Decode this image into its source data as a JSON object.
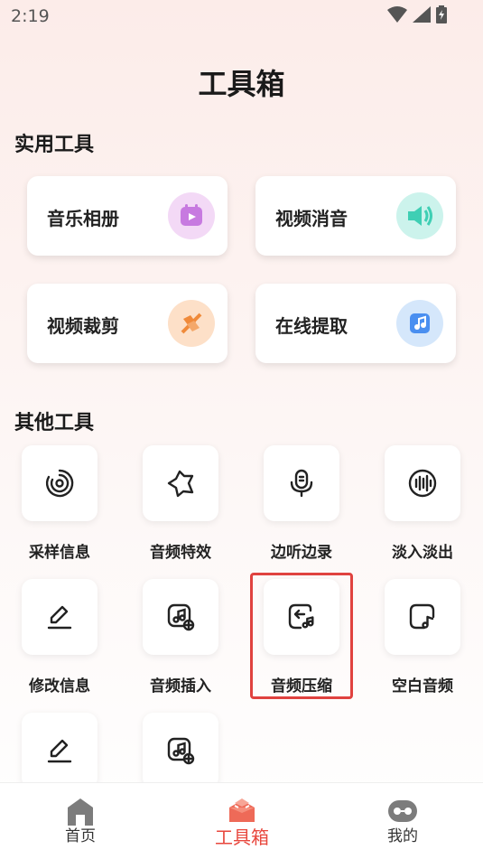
{
  "status": {
    "time": "2:19"
  },
  "header": {
    "title": "工具箱"
  },
  "sections": {
    "practical": {
      "title": "实用工具"
    },
    "other": {
      "title": "其他工具"
    }
  },
  "cards": [
    {
      "label": "音乐相册",
      "icon": "music-album-icon",
      "color": "#e7b4f0"
    },
    {
      "label": "视频消音",
      "icon": "mute-video-icon",
      "color": "#9fe6d9"
    },
    {
      "label": "视频裁剪",
      "icon": "crop-video-icon",
      "color": "#f8c49a"
    },
    {
      "label": "在线提取",
      "icon": "online-extract-icon",
      "color": "#a9d0f7"
    }
  ],
  "tools": [
    {
      "label": "采样信息",
      "icon": "sample-info-icon"
    },
    {
      "label": "音频特效",
      "icon": "audio-effect-icon"
    },
    {
      "label": "边听边录",
      "icon": "microphone-icon"
    },
    {
      "label": "淡入淡出",
      "icon": "fade-icon"
    },
    {
      "label": "修改信息",
      "icon": "edit-icon"
    },
    {
      "label": "音频插入",
      "icon": "audio-insert-icon"
    },
    {
      "label": "音频压缩",
      "icon": "audio-compress-icon"
    },
    {
      "label": "空白音频",
      "icon": "blank-audio-icon"
    },
    {
      "label": "",
      "icon": "edit-icon"
    },
    {
      "label": "",
      "icon": "audio-insert-icon"
    }
  ],
  "tabbar": {
    "items": [
      {
        "label": "首页",
        "icon": "home-icon"
      },
      {
        "label": "工具箱",
        "icon": "toolbox-icon",
        "active": true
      },
      {
        "label": "我的",
        "icon": "profile-icon"
      }
    ],
    "active_color": "#e8473d"
  }
}
